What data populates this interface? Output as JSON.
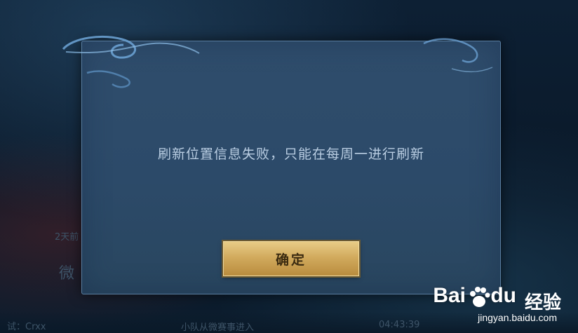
{
  "dialog": {
    "message": "刷新位置信息失败，只能在每周一进行刷新",
    "confirm_label": "确定"
  },
  "background": {
    "left_label": "2天前",
    "left_label2": "微",
    "bottom_left": "试：Crxx",
    "bottom_center": "小队从微赛事进入",
    "bottom_right": "04:43:39"
  },
  "watermark": {
    "brand_latin": "Bai",
    "brand_latin2": "du",
    "brand_cn": "经验",
    "url": "jingyan.baidu.com"
  },
  "colors": {
    "dialog_bg": "#2f4d6c",
    "button_gold": "#d2ab5e",
    "message_text": "#b9cde2"
  }
}
